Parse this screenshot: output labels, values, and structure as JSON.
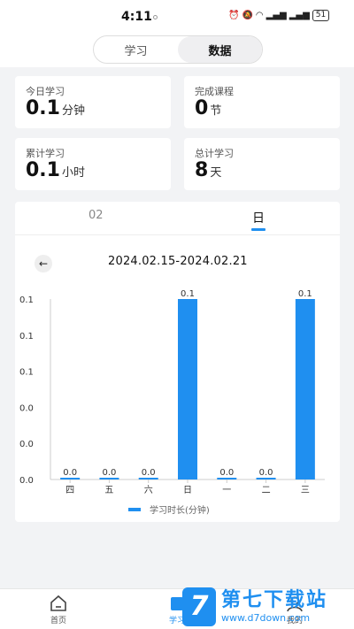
{
  "status": {
    "time": "4:11",
    "battery": "51"
  },
  "segmented": {
    "items": [
      "学习",
      "数据"
    ],
    "active_index": 1
  },
  "stats": [
    {
      "label": "今日学习",
      "value": "0.1",
      "unit": "分钟"
    },
    {
      "label": "完成课程",
      "value": "0",
      "unit": "节"
    },
    {
      "label": "累计学习",
      "value": "0.1",
      "unit": "小时"
    },
    {
      "label": "总计学习",
      "value": "8",
      "unit": "天"
    }
  ],
  "tabs": {
    "items": [
      "02",
      "日"
    ],
    "active_index": 1
  },
  "date_range": "2024.02.15-2024.02.21",
  "colors": {
    "accent": "#1f8ff0"
  },
  "chart_data": {
    "type": "bar",
    "categories": [
      "四",
      "五",
      "六",
      "日",
      "一",
      "二",
      "三"
    ],
    "series": [
      {
        "name": "学习时长(分钟)",
        "values": [
          0.0,
          0.0,
          0.0,
          0.1,
          0.0,
          0.0,
          0.1
        ]
      }
    ],
    "data_labels": [
      "0.0",
      "0.0",
      "0.0",
      "0.1",
      "0.0",
      "0.0",
      "0.1"
    ],
    "y_tick_labels": [
      "0.0",
      "0.0",
      "0.0",
      "0.1",
      "0.1",
      "0.1"
    ],
    "ylim": [
      0,
      0.1
    ],
    "grid": false,
    "legend": "bottom",
    "legend_label": "学习时长(分钟)"
  },
  "nav": {
    "items": [
      {
        "label": "首页",
        "icon": "home-icon"
      },
      {
        "label": "学习",
        "icon": "study-icon"
      },
      {
        "label": "我的",
        "icon": "profile-icon"
      }
    ],
    "active_index": 1
  },
  "watermark": {
    "logo": "7",
    "title": "第七下载站",
    "url": "www.d7down.com"
  }
}
